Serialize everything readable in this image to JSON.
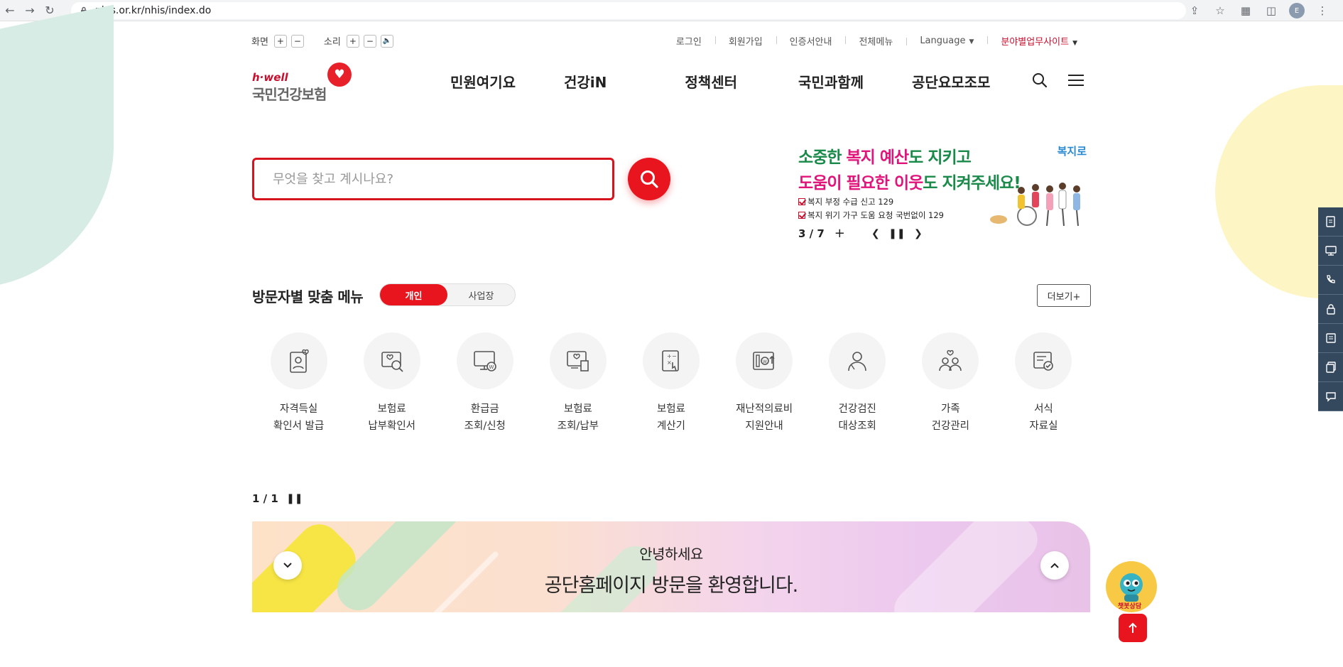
{
  "browser": {
    "url": "nhis.or.kr/nhis/index.do",
    "profile_initial": "E"
  },
  "utility": {
    "screen_label": "화면",
    "sound_label": "소리",
    "plus": "+",
    "minus": "−"
  },
  "top_links": [
    {
      "label": "로그인"
    },
    {
      "label": "회원가입"
    },
    {
      "label": "인증서안내"
    },
    {
      "label": "전체메뉴"
    },
    {
      "label": "Language"
    },
    {
      "label": "분야별업무사이트"
    }
  ],
  "logo": {
    "tagline": "h·well",
    "name": "국민건강보험"
  },
  "gnb": [
    "민원여기요",
    "건강iN",
    "정책센터",
    "국민과함께",
    "공단요모조모"
  ],
  "search": {
    "placeholder": "무엇을 찾고 계시나요?"
  },
  "banner": {
    "line1_a": "소중한 ",
    "line1_b": "복지 예산",
    "line1_c": "도 지키고",
    "line2_a": "도움이 필요한 이웃",
    "line2_b": "도 지켜주세요!",
    "sub1": "복지 부정 수급 신고 129",
    "sub2": "복지 위기 가구 도움 요청 국번없이 129",
    "logo_text": "복지로",
    "counter": "3 / 7",
    "plus": "+"
  },
  "visitor_menu": {
    "title": "방문자별 맞춤 메뉴",
    "tab_personal": "개인",
    "tab_business": "사업장",
    "more": "더보기+",
    "items": [
      {
        "line1": "자격득실",
        "line2": "확인서 발급",
        "icon": "id-card-icon"
      },
      {
        "line1": "보험료",
        "line2": "납부확인서",
        "icon": "search-doc-icon"
      },
      {
        "line1": "환급금",
        "line2": "조회/신청",
        "icon": "monitor-won-icon"
      },
      {
        "line1": "보험료",
        "line2": "조회/납부",
        "icon": "receipt-icon"
      },
      {
        "line1": "보험료",
        "line2": "계산기",
        "icon": "calculator-icon"
      },
      {
        "line1": "재난적의료비",
        "line2": "지원안내",
        "icon": "wallet-icon"
      },
      {
        "line1": "건강검진",
        "line2": "대상조회",
        "icon": "person-search-icon"
      },
      {
        "line1": "가족",
        "line2": "건강관리",
        "icon": "family-icon"
      },
      {
        "line1": "서식",
        "line2": "자료실",
        "icon": "form-doc-icon"
      }
    ],
    "pager": "1 / 1"
  },
  "welcome": {
    "greeting": "안녕하세요",
    "message": "공단홈페이지 방문을 환영합니다."
  },
  "chatbot": {
    "label": "챗봇상담"
  },
  "colors": {
    "primary": "#e8141e",
    "quickbar": "#34495e",
    "green": "#1a8a4a",
    "pink": "#e0147a"
  }
}
